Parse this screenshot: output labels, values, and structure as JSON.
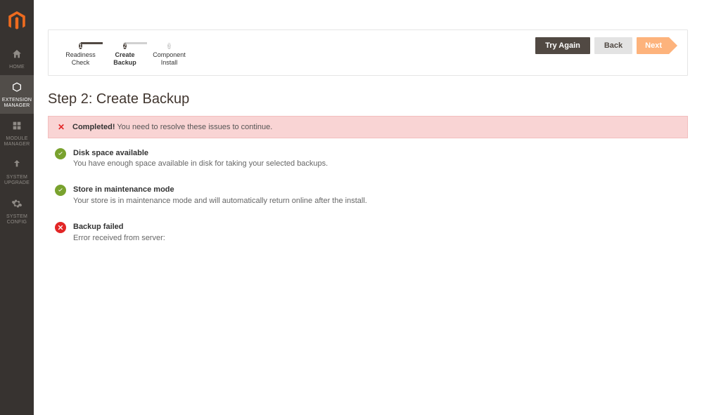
{
  "sidebar": {
    "items": [
      {
        "label": "HOME"
      },
      {
        "label": "EXTENSION MANAGER"
      },
      {
        "label": "MODULE MANAGER"
      },
      {
        "label": "SYSTEM UPGRADE"
      },
      {
        "label": "SYSTEM CONFIG"
      }
    ],
    "active_index": 1
  },
  "stepper": {
    "steps": [
      {
        "num": "1",
        "label_l1": "Readiness",
        "label_l2": "Check"
      },
      {
        "num": "2",
        "label_l1": "Create",
        "label_l2": "Backup"
      },
      {
        "num": "3",
        "label_l1": "Component",
        "label_l2": "Install"
      }
    ],
    "current_index": 1
  },
  "buttons": {
    "try_again": "Try Again",
    "back": "Back",
    "next": "Next"
  },
  "page": {
    "title": "Step 2: Create Backup"
  },
  "alert": {
    "strong": "Completed!",
    "text": " You need to resolve these issues to continue."
  },
  "checks": [
    {
      "status": "ok",
      "title": "Disk space available",
      "desc": "You have enough space available in disk for taking your selected backups."
    },
    {
      "status": "ok",
      "title": "Store in maintenance mode",
      "desc": "Your store is in maintenance mode and will automatically return online after the install."
    },
    {
      "status": "fail",
      "title": "Backup failed",
      "desc": "Error received from server:"
    }
  ]
}
